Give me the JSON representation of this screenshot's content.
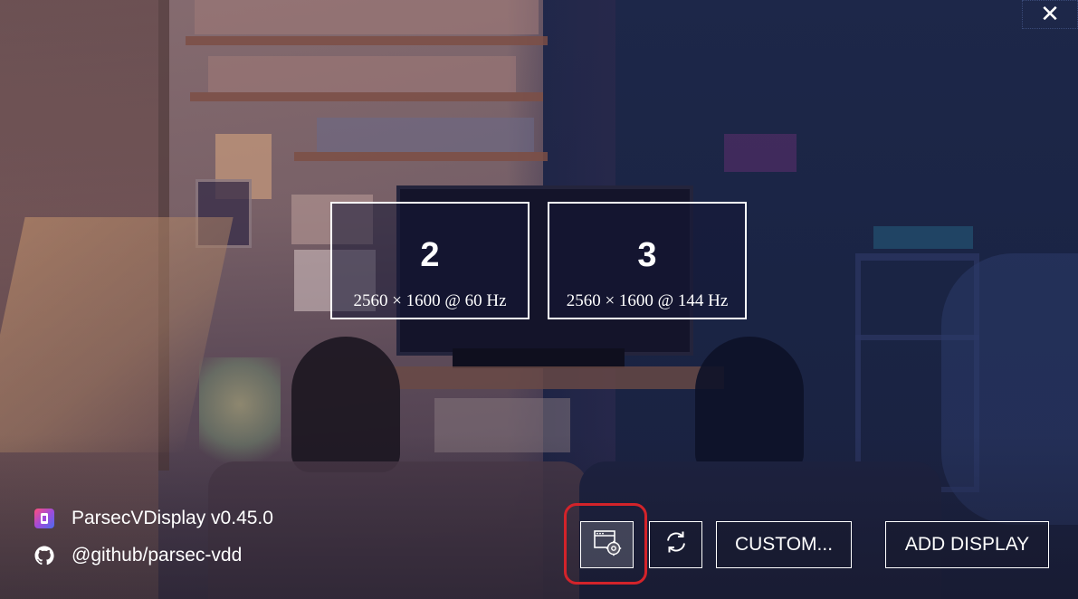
{
  "window": {
    "close_icon": "close-icon",
    "close_glyph": "✕"
  },
  "displays": [
    {
      "number": "2",
      "resolution": "2560 × 1600 @ 60 Hz"
    },
    {
      "number": "3",
      "resolution": "2560 × 1600 @ 144 Hz"
    }
  ],
  "footer": {
    "app_name": "ParsecVDisplay v0.45.0",
    "app_icon": "parsec-logo-icon",
    "github_link": "@github/parsec-vdd",
    "github_icon": "github-icon"
  },
  "toolbar": {
    "settings_icon": "window-settings-icon",
    "refresh_icon": "refresh-icon",
    "custom_label": "CUSTOM...",
    "add_display_label": "ADD DISPLAY"
  },
  "colors": {
    "highlight": "#d3232a",
    "text": "#ffffff",
    "border": "#ffffff"
  }
}
